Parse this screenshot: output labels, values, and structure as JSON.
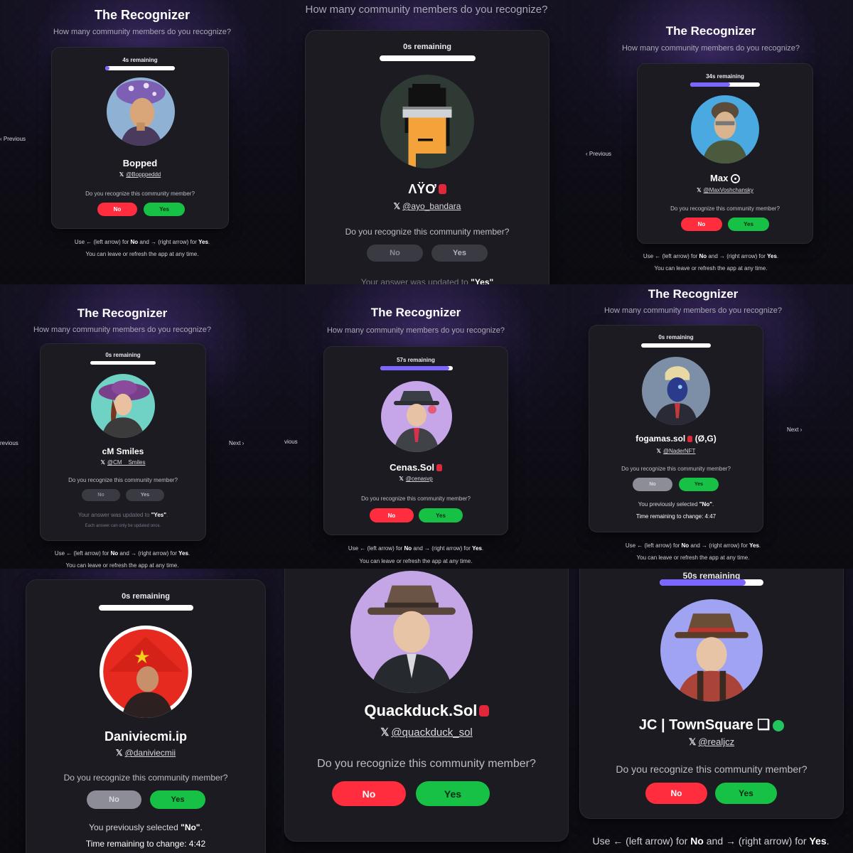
{
  "app": {
    "title": "The Recognizer",
    "subtitle": "How many community members do you recognize?",
    "question": "Do you recognize this community member?",
    "no_label": "No",
    "yes_label": "Yes",
    "previous_label": "‹ Previous",
    "previous_label_cut": "revious",
    "previous_label_cut2": "vious",
    "next_label": "Next ›",
    "hint_line1": {
      "a": "Use ← (left arrow) for ",
      "b": "No",
      "c": " and → (right arrow) for ",
      "d": "Yes",
      "e": "."
    },
    "hint_line2": "You can leave or refresh the app at any time.",
    "x_icon": "𝕏"
  },
  "colors": {
    "no": "#ff2d3d",
    "yes": "#16c146",
    "progress": "#7b66ff",
    "card": "#1b1b21"
  },
  "tiles": [
    {
      "timer": "4s remaining",
      "progress": 0.06,
      "name": "Bopped",
      "handle": "@Bopppeddd"
    },
    {
      "timer": "0s remaining",
      "progress": 0,
      "name": "ΛŸƠ",
      "handle": "@ayo_bandara",
      "footer_cut": {
        "a": "Your answer was updated to ",
        "b": "\"Yes\""
      }
    },
    {
      "timer": "34s remaining",
      "progress": 0.57,
      "name": "Max ⨀",
      "handle": "@MaxVoshchansky"
    },
    {
      "timer": "0s remaining",
      "progress": 0,
      "name": "cM Smiles",
      "handle": "@CM__Smiles",
      "updated": {
        "a": "Your answer was updated to ",
        "b": "\"Yes\"",
        "c": "."
      },
      "once": "Each answer can only be updated once."
    },
    {
      "timer": "57s remaining",
      "progress": 0.95,
      "name": "Cenas.Sol",
      "handle": "@cenasvp"
    },
    {
      "timer": "0s remaining",
      "progress": 0,
      "name": "fogamas.sol",
      "name_suffix": " (Ø,G)",
      "handle": "@NaderNFT",
      "prev": {
        "a": "You previously selected ",
        "b": "\"No\"",
        "c": "."
      },
      "change": "Time remaining to change: 4:47"
    },
    {
      "timer": "0s remaining",
      "progress": 0,
      "name": "Daniviecmi.ip",
      "handle": "@daniviecmii",
      "prev": {
        "a": "You previously selected ",
        "b": "\"No\"",
        "c": "."
      },
      "change": "Time remaining to change: 4:42"
    },
    {
      "name": "Quackduck.Sol",
      "handle": "@quackduck_sol"
    },
    {
      "timer": "50s remaining",
      "progress": 0.83,
      "name": "JC | TownSquare ❏",
      "handle": "@realjcz"
    }
  ]
}
